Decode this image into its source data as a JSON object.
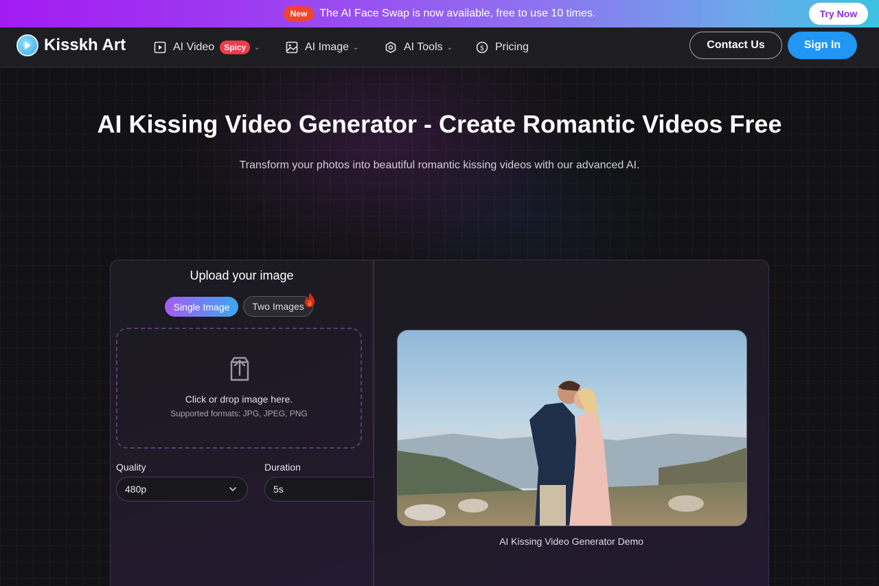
{
  "banner": {
    "badge": "New",
    "text": "The AI Face Swap is now available, free to use 10 times.",
    "cta": "Try Now"
  },
  "nav": {
    "brand": "Kisskh Art",
    "items": [
      {
        "label": "AI Video",
        "badge": "Spicy",
        "icon": "play-square-icon"
      },
      {
        "label": "AI Image",
        "icon": "image-icon"
      },
      {
        "label": "AI Tools",
        "icon": "hexagon-icon"
      },
      {
        "label": "Pricing",
        "icon": "dollar-circle-icon"
      }
    ],
    "contact": "Contact Us",
    "signin": "Sign In"
  },
  "hero": {
    "title": "AI Kissing Video Generator - Create Romantic Videos Free",
    "subtitle": "Transform your photos into beautiful romantic kissing videos with our advanced AI."
  },
  "upload": {
    "title": "Upload your image",
    "tabs": [
      "Single Image",
      "Two Images"
    ],
    "active_tab": "Single Image",
    "drop_text": "Click or drop image here.",
    "formats": "Supported formats: JPG, JPEG, PNG",
    "quality_label": "Quality",
    "quality_value": "480p",
    "duration_label": "Duration",
    "duration_value": "5s"
  },
  "demo": {
    "caption": "AI Kissing Video Generator Demo"
  },
  "colors": {
    "accent_blue": "#2196f3",
    "spicy_red": "#ef3b4b",
    "new_badge": "#f0442f"
  }
}
